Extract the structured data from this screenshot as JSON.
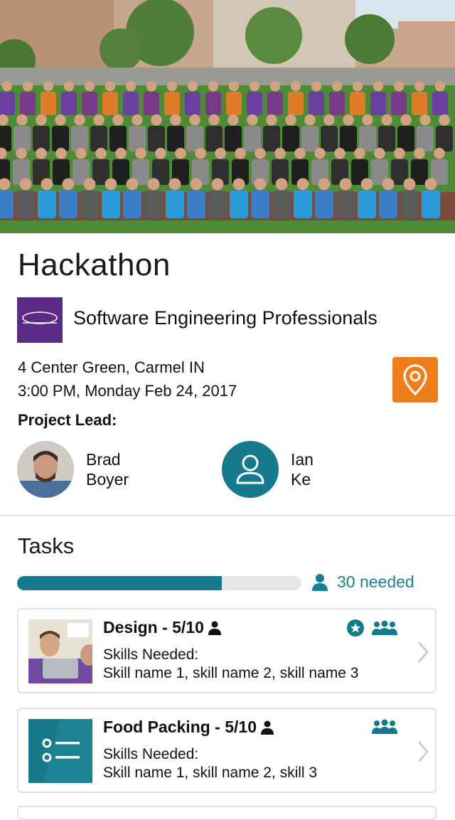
{
  "hero": {
    "image": "group-photo"
  },
  "event": {
    "title": "Hackathon",
    "organization": "Software Engineering Professionals",
    "address": "4 Center Green, Carmel IN",
    "datetime": "3:00 PM, Monday Feb 24, 2017"
  },
  "project_lead": {
    "label": "Project Lead:",
    "leads": [
      {
        "first": "Brad",
        "last": "Boyer",
        "avatar": "photo"
      },
      {
        "first": "Ian",
        "last": "Ke",
        "avatar": "person-icon"
      }
    ]
  },
  "tasks": {
    "title": "Tasks",
    "progress": 0.72,
    "needed_label": "30 needed",
    "items": [
      {
        "title": "Design - 5/10",
        "skills_label": "Skills Needed:",
        "skills": "Skill name 1, skill name 2, skill name 3",
        "thumb": "photo",
        "icons": [
          "star-icon",
          "group-icon"
        ]
      },
      {
        "title": "Food Packing - 5/10",
        "skills_label": "Skills Needed:",
        "skills": "Skill name 1, skill name 2, skill 3",
        "thumb": "list-icon",
        "icons": [
          "group-icon"
        ]
      }
    ]
  },
  "colors": {
    "accent": "#157a8c",
    "map_button": "#f07e1d",
    "org_logo": "#5b2a86"
  }
}
